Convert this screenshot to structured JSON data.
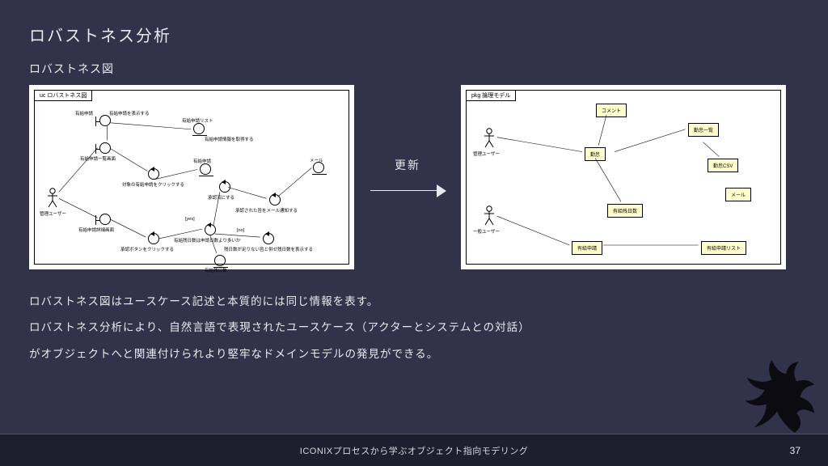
{
  "title": "ロバストネス分析",
  "subtitle": "ロバストネス図",
  "arrow_label": "更新",
  "left_tab": "uc ロバストネス図",
  "right_tab": "pkg 論理モデル",
  "left_labels": {
    "a1": "管理ユーザー",
    "l_b1": "有給申請",
    "l_b1s": "有給申請を表示する",
    "l_b2": "有給申請一覧画面",
    "l_b3": "有給申請詳細画面",
    "l_c1": "対象の有給申請をクリックする",
    "l_c2": "承認ボタンをクリックする",
    "l_c3": "有給残日数は申請日数より多いか",
    "l_e1": "有給申請リスト",
    "l_e1c": "有給申請情報を取得する",
    "l_e2": "有給申請",
    "l_e3": "有給残日数",
    "l_c4": "承認済にする",
    "l_c5": "承認された旨をメール通知する",
    "l_c6": "残日数が足りない旨と併せ残日数を表示する",
    "l_e4": "メール",
    "l_y": "[yes]",
    "l_n": "[no]"
  },
  "right_labels": {
    "a1": "管理ユーザー",
    "a2": "一般ユーザー",
    "e1": "コメント",
    "e2": "勤怠",
    "e3": "勤怠一覧",
    "e4": "勤怠CSV",
    "e5": "メール",
    "e6": "有給残日数",
    "e7": "有給申請",
    "e8": "有給申請リスト"
  },
  "paragraphs": [
    "ロバストネス図はユースケース記述と本質的には同じ情報を表す。",
    "ロバストネス分析により、自然言語で表現されたユースケース（アクターとシステムとの対話）",
    "がオブジェクトへと関連付けられより堅牢なドメインモデルの発見ができる。"
  ],
  "footer": "ICONIXプロセスから学ぶオブジェクト指向モデリング",
  "page": "37"
}
